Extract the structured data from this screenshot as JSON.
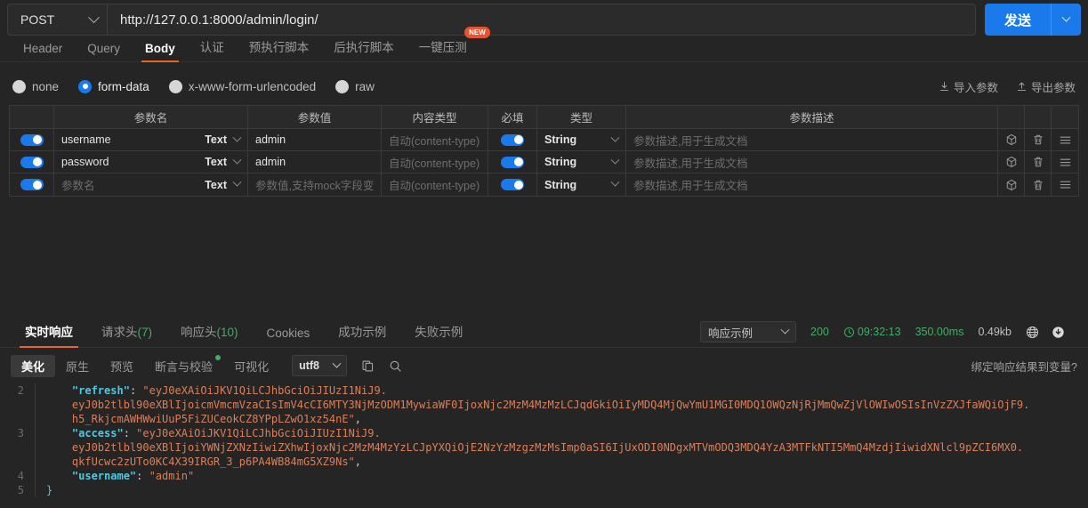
{
  "request": {
    "method": "POST",
    "url": "http://127.0.0.1:8000/admin/login/",
    "send_label": "发送"
  },
  "top_tabs": [
    {
      "label": "Header",
      "active": false,
      "badge": ""
    },
    {
      "label": "Query",
      "active": false,
      "badge": ""
    },
    {
      "label": "Body",
      "active": true,
      "badge": ""
    },
    {
      "label": "认证",
      "active": false,
      "badge": ""
    },
    {
      "label": "预执行脚本",
      "active": false,
      "badge": ""
    },
    {
      "label": "后执行脚本",
      "active": false,
      "badge": ""
    },
    {
      "label": "一键压测",
      "active": false,
      "badge": "NEW"
    }
  ],
  "body_type": {
    "options": [
      {
        "label": "none",
        "selected": false
      },
      {
        "label": "form-data",
        "selected": true
      },
      {
        "label": "x-www-form-urlencoded",
        "selected": false
      },
      {
        "label": "raw",
        "selected": false
      }
    ],
    "import_label": "导入参数",
    "export_label": "导出参数"
  },
  "param_table": {
    "headers": {
      "name": "参数名",
      "value": "参数值",
      "content_type": "内容类型",
      "required": "必填",
      "type": "类型",
      "description": "参数描述"
    },
    "rows": [
      {
        "enabled": true,
        "name": "username",
        "name_is_placeholder": false,
        "name_type": "Text",
        "value": "admin",
        "value_is_placeholder": false,
        "content_type": "自动(content-type)",
        "required": true,
        "type": "String",
        "description": "参数描述,用于生成文档"
      },
      {
        "enabled": true,
        "name": "password",
        "name_is_placeholder": false,
        "name_type": "Text",
        "value": "admin",
        "value_is_placeholder": false,
        "content_type": "自动(content-type)",
        "required": true,
        "type": "String",
        "description": "参数描述,用于生成文档"
      },
      {
        "enabled": true,
        "name": "参数名",
        "name_is_placeholder": true,
        "name_type": "Text",
        "value": "参数值,支持mock字段变",
        "value_is_placeholder": true,
        "content_type": "自动(content-type)",
        "required": true,
        "type": "String",
        "description": "参数描述,用于生成文档"
      }
    ]
  },
  "response_tabs": [
    {
      "label": "实时响应",
      "count": "",
      "active": true
    },
    {
      "label": "请求头",
      "count": "(7)",
      "active": false
    },
    {
      "label": "响应头",
      "count": "(10)",
      "active": false
    },
    {
      "label": "Cookies",
      "count": "",
      "active": false
    },
    {
      "label": "成功示例",
      "count": "",
      "active": false
    },
    {
      "label": "失败示例",
      "count": "",
      "active": false
    }
  ],
  "response_meta": {
    "example_select": "响应示例",
    "status": "200",
    "time": "09:32:13",
    "duration": "350.00ms",
    "size": "0.49kb"
  },
  "view_toolbar": {
    "tabs": [
      {
        "label": "美化",
        "active": true,
        "dot": false
      },
      {
        "label": "原生",
        "active": false,
        "dot": false
      },
      {
        "label": "预览",
        "active": false,
        "dot": false
      },
      {
        "label": "断言与校验",
        "active": false,
        "dot": true
      },
      {
        "label": "可视化",
        "active": false,
        "dot": false
      }
    ],
    "encoding": "utf8",
    "bind_link": "绑定响应结果到变量?"
  },
  "code_lines": [
    {
      "num": "2",
      "segments": [
        {
          "t": "    ",
          "c": "p"
        },
        {
          "t": "\"refresh\"",
          "c": "k"
        },
        {
          "t": ": ",
          "c": "p"
        },
        {
          "t": "\"eyJ0eXAiOiJKV1QiLCJhbGciOiJIUzI1NiJ9.",
          "c": "s"
        }
      ]
    },
    {
      "num": "",
      "segments": [
        {
          "t": "    eyJ0b2tlbl90eXBlIjoicmVmcmVzaCIsImV4cCI6MTY3NjMzODM1MywiaWF0IjoxNjc2MzM4MzMzLCJqdGkiOiIyMDQ4MjQwYmU1MGI0MDQ1OWQzNjRjMmQwZjVlOWIwOSIsInVzZXJfaWQiOjF9.",
          "c": "s"
        }
      ]
    },
    {
      "num": "",
      "segments": [
        {
          "t": "    h5_RkjcmAWHWwiUuP5FiZUCeokCZ8YPpLZwO1xz54nE\"",
          "c": "s"
        },
        {
          "t": ",",
          "c": "p"
        }
      ]
    },
    {
      "num": "3",
      "segments": [
        {
          "t": "    ",
          "c": "p"
        },
        {
          "t": "\"access\"",
          "c": "k"
        },
        {
          "t": ": ",
          "c": "p"
        },
        {
          "t": "\"eyJ0eXAiOiJKV1QiLCJhbGciOiJIUzI1NiJ9.",
          "c": "s"
        }
      ]
    },
    {
      "num": "",
      "segments": [
        {
          "t": "    eyJ0b2tlbl90eXBlIjoiYWNjZXNzIiwiZXhwIjoxNjc2MzM4MzYzLCJpYXQiOjE2NzYzMzgzMzMsImp0aSI6IjUxODI0NDgxMTVmODQ3MDQ4YzA3MTFkNTI5MmQ4MzdjIiwidXNlcl9pZCI6MX0.",
          "c": "s"
        }
      ]
    },
    {
      "num": "",
      "segments": [
        {
          "t": "    qkfUcwc2zUTo0KC4X39IRGR_3_p6PA4WB84mG5XZ9Ns\"",
          "c": "s"
        },
        {
          "t": ",",
          "c": "p"
        }
      ]
    },
    {
      "num": "4",
      "segments": [
        {
          "t": "    ",
          "c": "p"
        },
        {
          "t": "\"username\"",
          "c": "k"
        },
        {
          "t": ": ",
          "c": "p"
        },
        {
          "t": "\"admin\"",
          "c": "s"
        }
      ]
    },
    {
      "num": "5",
      "segments": [
        {
          "t": "}",
          "c": "b"
        }
      ]
    }
  ]
}
